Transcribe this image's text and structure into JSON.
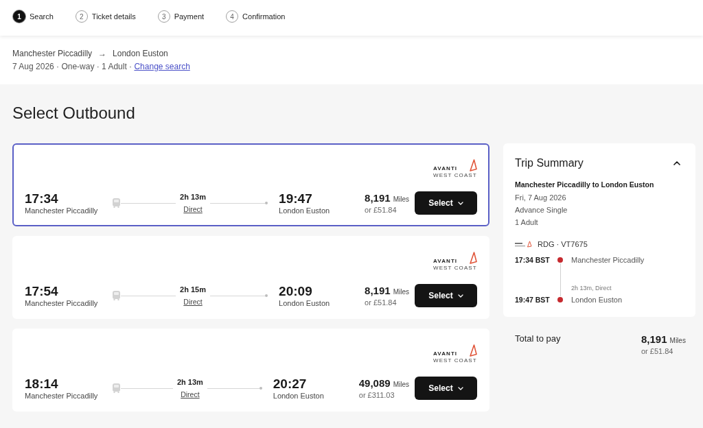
{
  "steps": [
    {
      "number": "1",
      "label": "Search",
      "selected": true
    },
    {
      "number": "2",
      "label": "Ticket details",
      "selected": false
    },
    {
      "number": "3",
      "label": "Payment",
      "selected": false
    },
    {
      "number": "4",
      "label": "Confirmation",
      "selected": false
    }
  ],
  "search_summary": {
    "origin": "Manchester Piccadilly",
    "arrow": "→",
    "destination": "London Euston",
    "details": "7 Aug 2026 · One-way · 1 Adult ·",
    "change_link": "Change search"
  },
  "heading": "Select Outbound",
  "journeys": [
    {
      "selected": true,
      "operator": {
        "name": "AVANTI",
        "subname": "WEST COAST"
      },
      "depart_time": "17:34",
      "depart_station": "Manchester Piccadilly",
      "duration": "2h 13m",
      "changes": "Direct",
      "arrive_time": "19:47",
      "arrive_station": "London Euston",
      "miles": "8,191",
      "miles_unit": "Miles",
      "price": "or £51.84",
      "button": "Select"
    },
    {
      "selected": false,
      "operator": {
        "name": "AVANTI",
        "subname": "WEST COAST"
      },
      "depart_time": "17:54",
      "depart_station": "Manchester Piccadilly",
      "duration": "2h 15m",
      "changes": "Direct",
      "arrive_time": "20:09",
      "arrive_station": "London Euston",
      "miles": "8,191",
      "miles_unit": "Miles",
      "price": "or £51.84",
      "button": "Select"
    },
    {
      "selected": false,
      "operator": {
        "name": "AVANTI",
        "subname": "WEST COAST"
      },
      "depart_time": "18:14",
      "depart_station": "Manchester Piccadilly",
      "duration": "2h 13m",
      "changes": "Direct",
      "arrive_time": "20:27",
      "arrive_station": "London Euston",
      "miles": "49,089",
      "miles_unit": "Miles",
      "price": "or £311.03",
      "button": "Select"
    }
  ],
  "trip_summary": {
    "title": "Trip Summary",
    "expanded": true,
    "route": "Manchester Piccadilly to London Euston",
    "date": "Fri, 7 Aug 2026",
    "ticket_type": "Advance Single",
    "passengers": "1 Adult",
    "service": "RDG · VT7675",
    "timeline": [
      {
        "kind": "stop",
        "time": "17:34 BST",
        "station": "Manchester Piccadilly"
      },
      {
        "kind": "leg",
        "info": "2h 13m, Direct"
      },
      {
        "kind": "stop",
        "time": "19:47 BST",
        "station": "London Euston"
      }
    ]
  },
  "total": {
    "label": "Total to pay",
    "miles": "8,191",
    "miles_unit": "Miles",
    "price": "or £51.84"
  }
}
